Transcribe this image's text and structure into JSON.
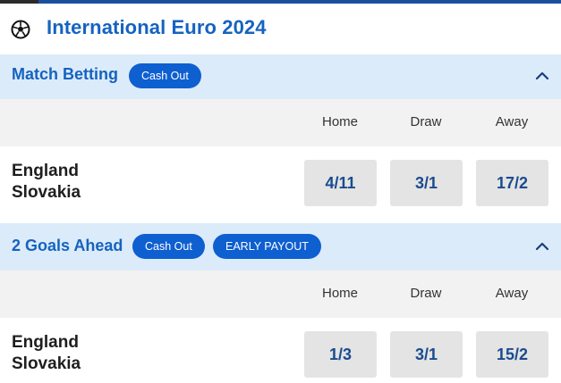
{
  "header": {
    "title": "International Euro 2024",
    "icon": "soccer-ball-icon"
  },
  "markets": [
    {
      "title": "Match Betting",
      "badges": [
        "Cash Out"
      ],
      "columns": [
        "Home",
        "Draw",
        "Away"
      ],
      "match": {
        "home_team": "England",
        "away_team": "Slovakia"
      },
      "odds": [
        "4/11",
        "3/1",
        "17/2"
      ]
    },
    {
      "title": "2 Goals Ahead",
      "badges": [
        "Cash Out",
        "EARLY PAYOUT"
      ],
      "columns": [
        "Home",
        "Draw",
        "Away"
      ],
      "match": {
        "home_team": "England",
        "away_team": "Slovakia"
      },
      "odds": [
        "1/3",
        "3/1",
        "15/2"
      ]
    }
  ],
  "colors": {
    "brand_blue": "#1563c0",
    "pill_blue": "#0e5fd0",
    "section_bg": "#dcebfa",
    "odds_bg": "#e4e4e4"
  }
}
